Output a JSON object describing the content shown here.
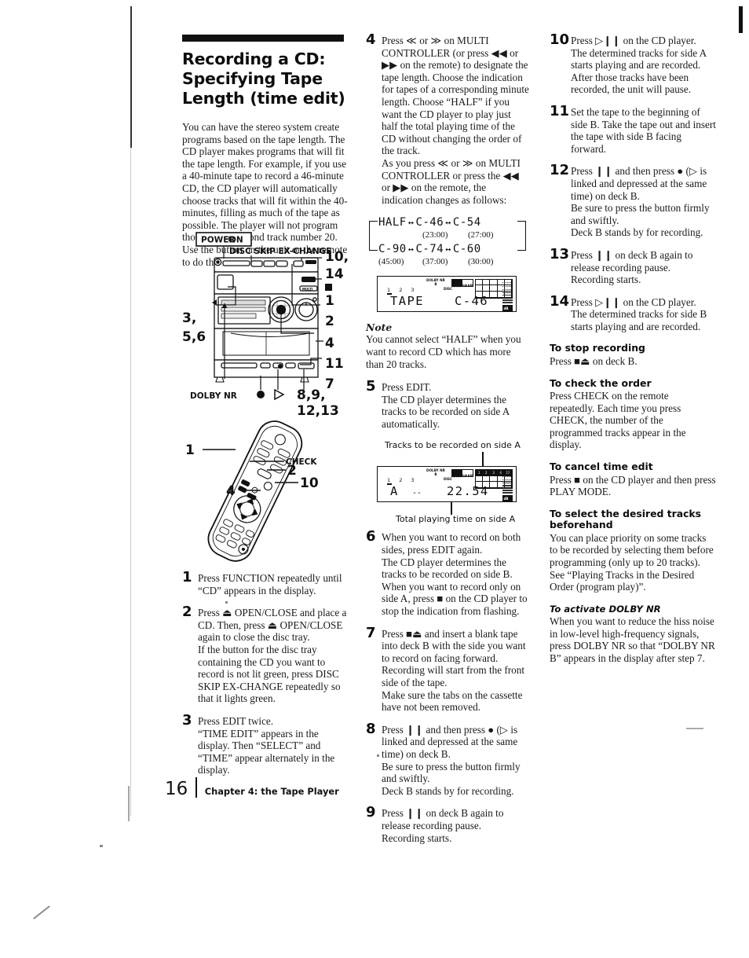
{
  "page": {
    "number": "16",
    "chapter": "Chapter 4: the Tape Player"
  },
  "heading": {
    "title": "Recording a CD: Specifying Tape Length (time edit)",
    "intro": "You can have the stereo system create programs based on the tape length. The CD player makes programs that will fit the tape length. For example, if you use a 40-minute tape to record a 46-minute CD, the CD player will automatically choose tracks that will fit within the 40-minutes, filling as much of the tape as possible. The player will not program those tracks beyond track number 20. Use the button on the unit or the remote to do this operation."
  },
  "unit_diagram": {
    "power_label": "POWER→ON",
    "disc_skip_label": "DISC SKIP EX-CHANGE",
    "dolby_label": "DOLBY NR",
    "callout_left_top": "3,",
    "callout_left_bottom": "5,6",
    "callout_10_14": "10,",
    "callout_14": "14",
    "callout_1": "1",
    "callout_2": "2",
    "callout_4": "4",
    "callout_11": "11",
    "callout_7": "7",
    "callout_89": "8,9,",
    "callout_1213": "12,13"
  },
  "remote_diagram": {
    "callout_1": "1",
    "callout_2": "2",
    "callout_4": "4",
    "callout_10": "10",
    "check_label": "CHECK"
  },
  "steps_col1": [
    {
      "num": "1",
      "text": "Press FUNCTION repeatedly until “CD” appears in the display."
    },
    {
      "num": "2",
      "text": "Press ⏏ OPEN/CLOSE and place a CD. Then, press ⏏ OPEN/CLOSE again to close the disc tray.\nIf the button for the disc tray containing the CD you want to record is not lit green, press DISC SKIP EX-CHANGE repeatedly so that it lights green."
    },
    {
      "num": "3",
      "text": "Press EDIT twice.\n“TIME EDIT” appears in the display. Then “SELECT” and “TIME” appear alternately in the display."
    }
  ],
  "steps_col2": {
    "step4": {
      "num": "4",
      "text": "Press ≪ or ≫ on MULTI CONTROLLER (or press ◀◀ or ▶▶ on the remote) to designate the tape length. Choose the indication for tapes of a corresponding minute length.  Choose “HALF” if you want the CD player to play just half the total playing time of the CD without changing the order of the track.\nAs you press ≪ or ≫ on MULTI CONTROLLER or press the ◀◀ or ▶▶ on the remote, the indication changes as follows:"
    },
    "flow": {
      "top": [
        "HALF",
        "C-46",
        "C-54"
      ],
      "top_times": [
        "",
        "(23:00)",
        "(27:00)"
      ],
      "bottom": [
        "C-90",
        "C-74",
        "C-60"
      ],
      "bottom_times": [
        "(45:00)",
        "(37:00)",
        "(30:00)"
      ]
    },
    "lcd1": {
      "tracknums": "1  2  3",
      "main": "TAPE",
      "right": "C-46",
      "dolby": "DOLBY NR\nB",
      "disc": "DISC",
      "program": "PROGRAM",
      "matrix_on": []
    },
    "note": {
      "label": "Note",
      "text": "You cannot select “HALF” when you want to record CD which has more than 20 tracks."
    },
    "step5": {
      "num": "5",
      "text": "Press EDIT.\nThe CD player determines the tracks to be recorded on side A automatically."
    },
    "lcd2_caption_top": "Tracks to be recorded on side A",
    "lcd2_caption_bottom": "Total playing time on side A",
    "lcd2": {
      "tracknums": "1  2  3",
      "main": "A",
      "dashes": "--",
      "right": "22.54",
      "dolby": "DOLBY NR\nB",
      "disc": "DISC",
      "program": "PROGRAM",
      "matrix_on": [
        "1",
        "2",
        "3",
        "4",
        "12"
      ]
    },
    "step6": {
      "num": "6",
      "text": "When you want to record on both sides, press EDIT again.\nThe CD player determines the tracks to be recorded on side B.\nWhen you want to record only on side A, press ■ on the CD player to stop the indication from flashing."
    },
    "step7": {
      "num": "7",
      "text": "Press ■⏏ and insert a blank tape into deck B with the side you want to record on facing forward.\nRecording will start from the front side of the tape.\nMake sure the tabs on the cassette have not been removed."
    },
    "step8": {
      "num": "8",
      "text": "Press ❙❙ and then press ● (▷ is linked and depressed at the same time) on deck B.\nBe sure to press the button firmly and swiftly.\nDeck B stands by for recording."
    },
    "step9": {
      "num": "9",
      "text": "Press ❙❙ on deck B again to release recording pause.\nRecording starts."
    }
  },
  "steps_col3": {
    "step10": {
      "num": "10",
      "text": "Press ▷❙❙ on the CD player.\nThe determined tracks for side A starts playing and are recorded.  After those tracks have been recorded, the unit will pause."
    },
    "step11": {
      "num": "11",
      "text": "Set the tape to the beginning of side B. Take the tape out and insert the tape with side B facing forward."
    },
    "step12": {
      "num": "12",
      "text": "Press ❙❙ and then press ● (▷ is linked and depressed at the same time) on deck B.\nBe sure to press the button firmly and swiftly.\nDeck B stands by for recording."
    },
    "step13": {
      "num": "13",
      "text": "Press ❙❙ on deck B again to release recording pause.\nRecording starts."
    },
    "step14": {
      "num": "14",
      "text": "Press ▷❙❙ on the CD player.\nThe determined tracks for side B starts playing and are recorded."
    },
    "sections": [
      {
        "heading": "To stop recording",
        "text": "Press ■⏏ on deck B.",
        "italic": false
      },
      {
        "heading": "To check the order",
        "text": "Press CHECK on the remote repeatedly. Each time you press CHECK, the number of the programmed tracks appear in the display.",
        "italic": false
      },
      {
        "heading": "To cancel time edit",
        "text": "Press ■ on the CD player and then press PLAY MODE.",
        "italic": false
      },
      {
        "heading": "To select the desired tracks beforehand",
        "text": "You can place priority on some tracks to be recorded by selecting them before programming (only up to 20 tracks). See “Playing Tracks in the Desired Order (program play)”.",
        "italic": false
      },
      {
        "heading": "To activate DOLBY NR",
        "text": "When you want to reduce the hiss noise in low-level high-frequency signals, press DOLBY NR so that “DOLBY NR B” appears in the display after step 7.",
        "italic": true
      }
    ]
  }
}
